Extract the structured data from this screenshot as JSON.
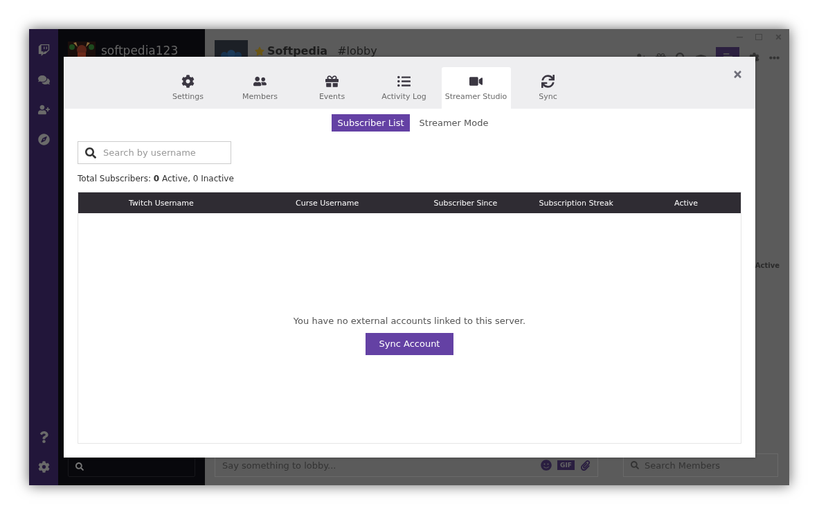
{
  "app": {
    "user": {
      "name": "softpedia123"
    },
    "server": {
      "name": "Softpedia",
      "channel": "#lobby",
      "favorite": true
    },
    "members_panel": {
      "status_label": "Active"
    },
    "chat_input": {
      "placeholder": "Say something to lobby...",
      "gif_label": "GIF"
    },
    "member_search": {
      "placeholder": "Search Members"
    }
  },
  "dialog": {
    "tabs": [
      {
        "label": "Settings",
        "kind": "gear",
        "selected": false
      },
      {
        "label": "Members",
        "kind": "members",
        "selected": false
      },
      {
        "label": "Events",
        "kind": "gift",
        "selected": false
      },
      {
        "label": "Activity Log",
        "kind": "list",
        "selected": false
      },
      {
        "label": "Streamer Studio",
        "kind": "camera",
        "selected": true
      },
      {
        "label": "Sync",
        "kind": "sync",
        "selected": false
      }
    ],
    "subtabs": [
      {
        "label": "Subscriber List",
        "selected": true
      },
      {
        "label": "Streamer Mode",
        "selected": false
      }
    ],
    "search": {
      "placeholder": "Search by username"
    },
    "summary": "Total Subscribers: **0** Active, 0 Inactive",
    "table": {
      "columns": [
        "Twitch Username",
        "Curse Username",
        "Subscriber Since",
        "Subscription Streak",
        "Active"
      ]
    },
    "empty_message": "You have no external accounts linked to this server.",
    "button": "Sync Account"
  }
}
